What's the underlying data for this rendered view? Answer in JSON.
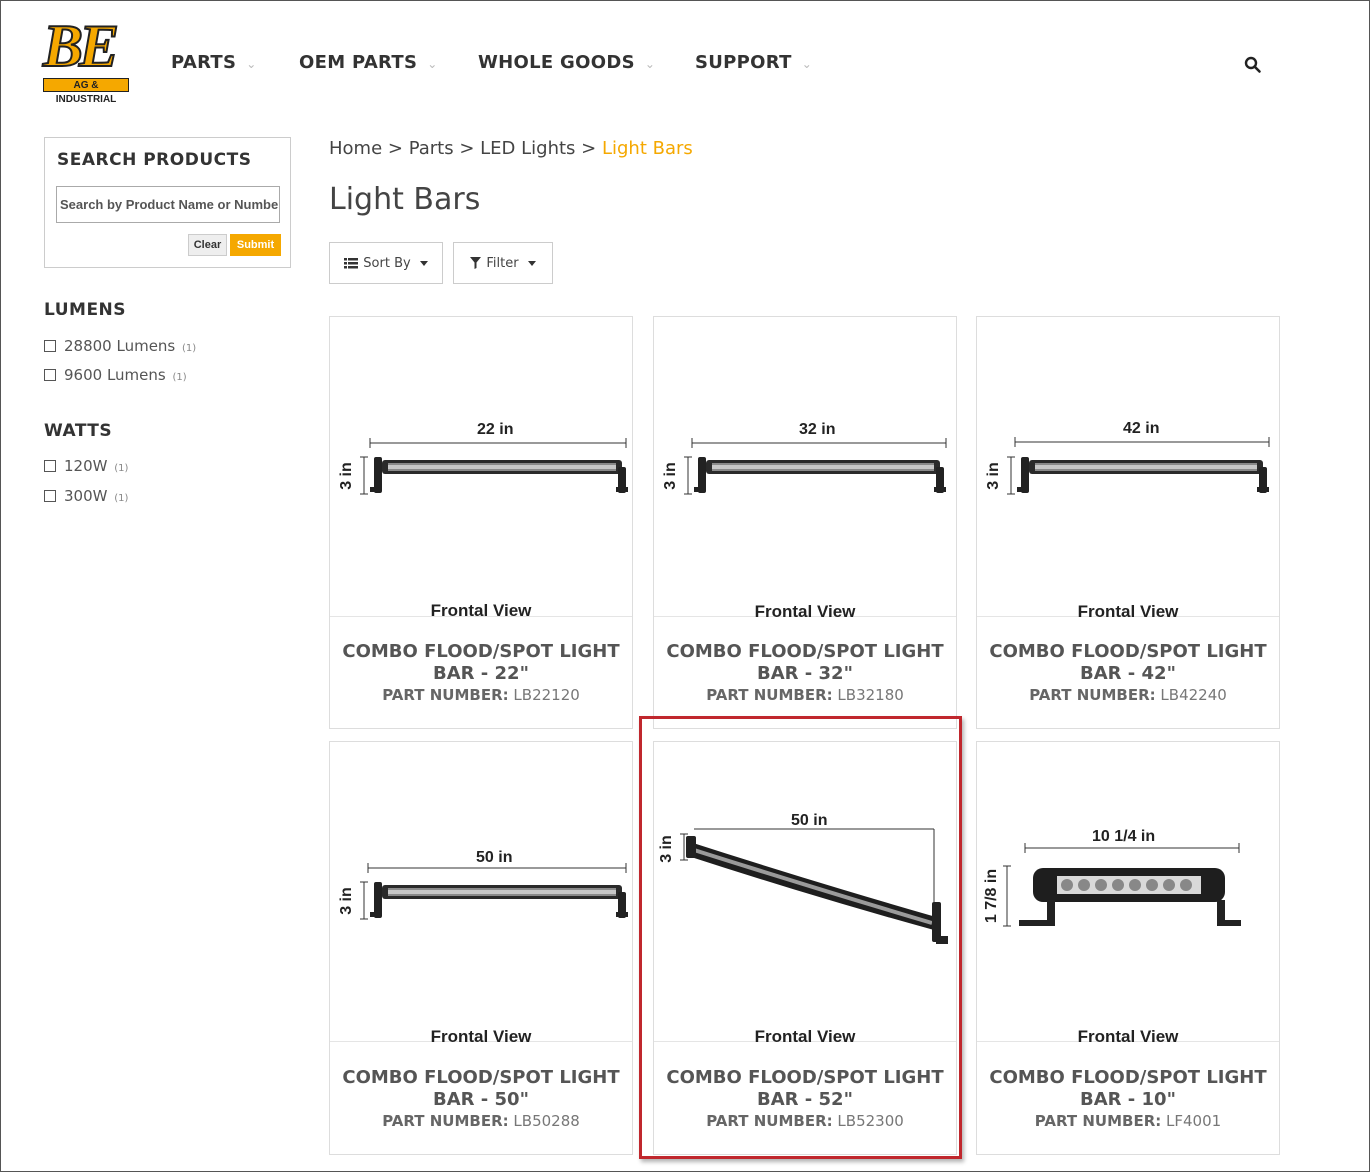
{
  "header": {
    "logo_text": "BE",
    "logo_subtext": "AG & INDUSTRIAL",
    "nav": [
      {
        "label": "PARTS"
      },
      {
        "label": "OEM PARTS"
      },
      {
        "label": "WHOLE GOODS"
      },
      {
        "label": "SUPPORT"
      }
    ],
    "search_icon": "search-icon"
  },
  "sidebar": {
    "search_title": "SEARCH PRODUCTS",
    "search_placeholder": "Search by Product Name or Number",
    "clear_label": "Clear",
    "submit_label": "Submit",
    "facets": [
      {
        "title": "LUMENS",
        "options": [
          {
            "label": "28800 Lumens",
            "count": "(1)"
          },
          {
            "label": "9600 Lumens",
            "count": "(1)"
          }
        ]
      },
      {
        "title": "WATTS",
        "options": [
          {
            "label": "120W",
            "count": "(1)"
          },
          {
            "label": "300W",
            "count": "(1)"
          }
        ]
      }
    ]
  },
  "breadcrumb": {
    "items": [
      "Home",
      "Parts",
      "LED Lights"
    ],
    "separator": " > ",
    "current": "Light Bars"
  },
  "page_title": "Light Bars",
  "toolbar": {
    "sort_label": "Sort By",
    "filter_label": "Filter"
  },
  "products": [
    {
      "name_line1": "COMBO FLOOD/SPOT LIGHT",
      "name_line2": "BAR - 22\"",
      "part_label": "PART NUMBER:",
      "part_number": "LB22120",
      "view": "Frontal View",
      "width_dim": "22 in",
      "height_dim": "3 in"
    },
    {
      "name_line1": "COMBO FLOOD/SPOT LIGHT",
      "name_line2": "BAR - 32\"",
      "part_label": "PART NUMBER:",
      "part_number": "LB32180",
      "view": "Frontal View",
      "width_dim": "32 in",
      "height_dim": "3 in"
    },
    {
      "name_line1": "COMBO FLOOD/SPOT LIGHT",
      "name_line2": "BAR - 42\"",
      "part_label": "PART NUMBER:",
      "part_number": "LB42240",
      "view": "Frontal View",
      "width_dim": "42 in",
      "height_dim": "3 in"
    },
    {
      "name_line1": "COMBO FLOOD/SPOT LIGHT",
      "name_line2": "BAR - 50\"",
      "part_label": "PART NUMBER:",
      "part_number": "LB50288",
      "view": "Frontal View",
      "width_dim": "50 in",
      "height_dim": "3 in"
    },
    {
      "name_line1": "COMBO FLOOD/SPOT LIGHT",
      "name_line2": "BAR - 52\"",
      "part_label": "PART NUMBER:",
      "part_number": "LB52300",
      "view": "Frontal View",
      "width_dim": "50 in",
      "height_dim": "3 in"
    },
    {
      "name_line1": "COMBO FLOOD/SPOT LIGHT",
      "name_line2": "BAR - 10\"",
      "part_label": "PART NUMBER:",
      "part_number": "LF4001",
      "view": "Frontal View",
      "width_dim": "10 1/4 in",
      "height_dim": "1 7/8 in"
    }
  ],
  "colors": {
    "accent": "#f5a800",
    "highlight": "#c0272d"
  }
}
